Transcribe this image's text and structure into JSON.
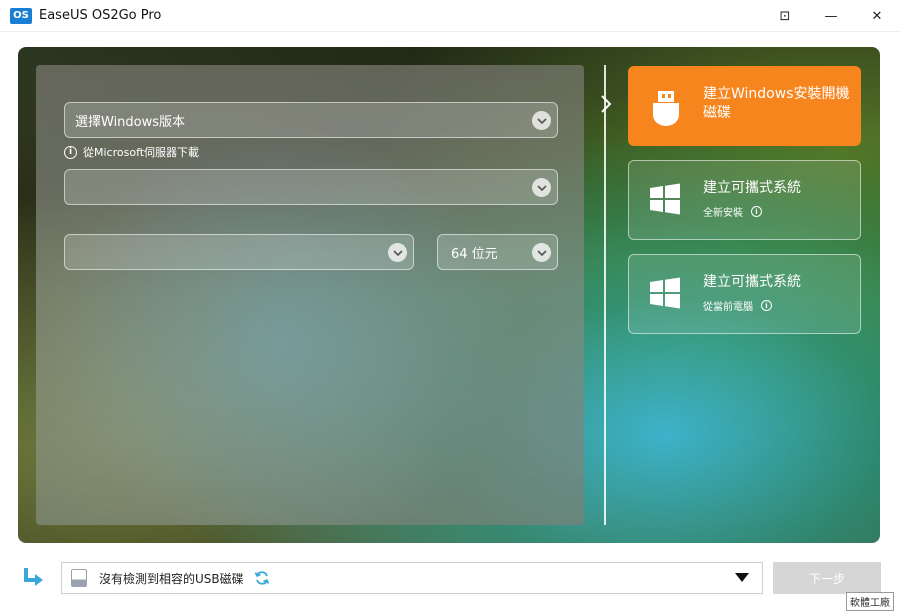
{
  "window": {
    "logo_text": "OS",
    "title": "EaseUS OS2Go Pro",
    "controls": [
      "⊡",
      "—",
      "✕"
    ]
  },
  "form": {
    "windows_version_placeholder": "選擇Windows版本",
    "download_info": "從Microsoft伺服器下載",
    "edition_placeholder": "",
    "language_placeholder": "",
    "arch_value": "64 位元"
  },
  "options": [
    {
      "title": "建立Windows安裝開機磁碟",
      "subtitle": "",
      "active": true,
      "icon": "usb-drive-icon"
    },
    {
      "title": "建立可攜式系統",
      "subtitle": "全新安裝",
      "active": false,
      "icon": "windows-logo-icon"
    },
    {
      "title": "建立可攜式系統",
      "subtitle": "從當前電腦",
      "active": false,
      "icon": "windows-logo-icon"
    }
  ],
  "bottom": {
    "usb_status": "沒有檢測到相容的USB磁碟",
    "next_label": "下一步"
  },
  "watermark": "軟體工廠",
  "colors": {
    "accent": "#f7851e",
    "logo": "#1a7fd4",
    "disabled": "#d6d6d6"
  }
}
